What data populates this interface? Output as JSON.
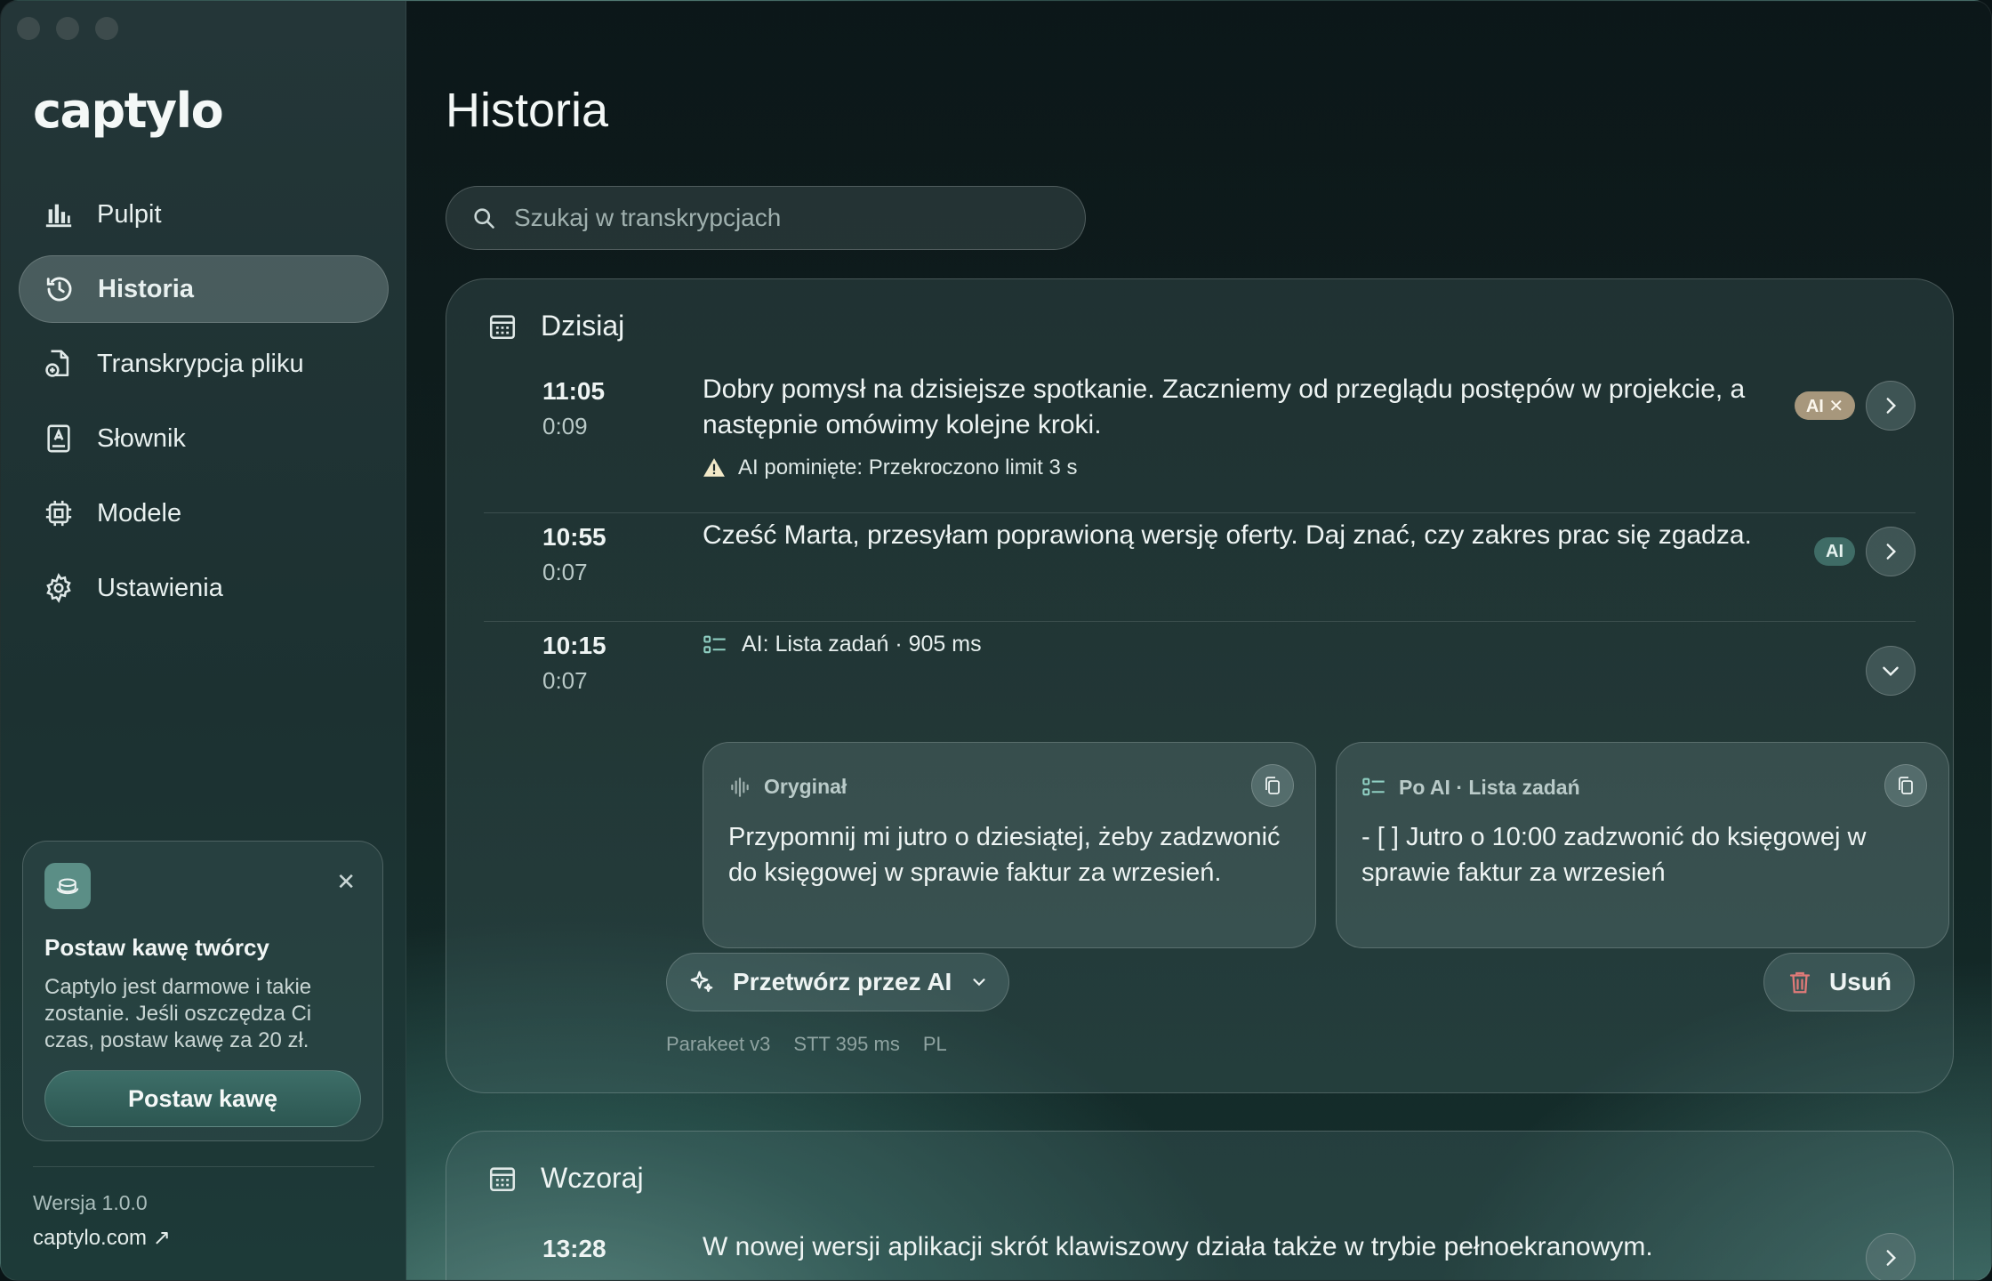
{
  "app": {
    "logo": "captylo"
  },
  "sidebar": {
    "items": [
      {
        "label": "Pulpit",
        "icon": "chart-bars-icon"
      },
      {
        "label": "Historia",
        "icon": "history-icon",
        "active": true
      },
      {
        "label": "Transkrypcja pliku",
        "icon": "file-add-icon"
      },
      {
        "label": "Słownik",
        "icon": "dictionary-icon"
      },
      {
        "label": "Modele",
        "icon": "chip-icon"
      },
      {
        "label": "Ustawienia",
        "icon": "gear-icon"
      }
    ],
    "promo": {
      "title": "Postaw kawę twórcy",
      "text": "Captylo jest darmowe i takie zostanie. Jeśli oszczędza Ci czas, postaw kawę za 20 zł.",
      "button": "Postaw kawę",
      "close": "✕"
    },
    "version": "Wersja 1.0.0",
    "site": "captylo.com ↗"
  },
  "main": {
    "title": "Historia",
    "search_placeholder": "Szukaj w transkrypcjach",
    "today": {
      "label": "Dzisiaj",
      "entries": [
        {
          "time": "11:05",
          "duration": "0:09",
          "text": "Dobry pomysł na dzisiejsze spotkanie. Zaczniemy od przeglądu postępów w projekcie, a następnie omówimy kolejne kroki.",
          "warning": "AI pominięte: Przekroczono limit 3 s",
          "badge": "AI ✕"
        },
        {
          "time": "10:55",
          "duration": "0:07",
          "text": "Cześć Marta, przesyłam poprawioną wersję oferty. Daj znać, czy zakres prac się zgadza.",
          "badge": "AI"
        },
        {
          "time": "10:15",
          "duration": "0:07",
          "ai_label": "AI: Lista zadań · 905 ms",
          "original_title": "Oryginał",
          "original_text": "Przypomnij mi jutro o dziesiątej, żeby zadzwonić do księgowej w sprawie faktur za wrzesień.",
          "processed_title": "Po AI · Lista zadań",
          "processed_text": "- [ ] Jutro o 10:00 zadzwonić do księgowej w sprawie faktur za wrzesień",
          "process_button": "Przetwórz przez AI",
          "delete_button": "Usuń",
          "meta": [
            "Parakeet v3",
            "STT 395 ms",
            "PL"
          ]
        }
      ]
    },
    "yesterday": {
      "label": "Wczoraj",
      "entries": [
        {
          "time": "13:28",
          "text": "W nowej wersji aplikacji skrót klawiszowy działa także w trybie pełnoekranowym."
        }
      ]
    }
  }
}
